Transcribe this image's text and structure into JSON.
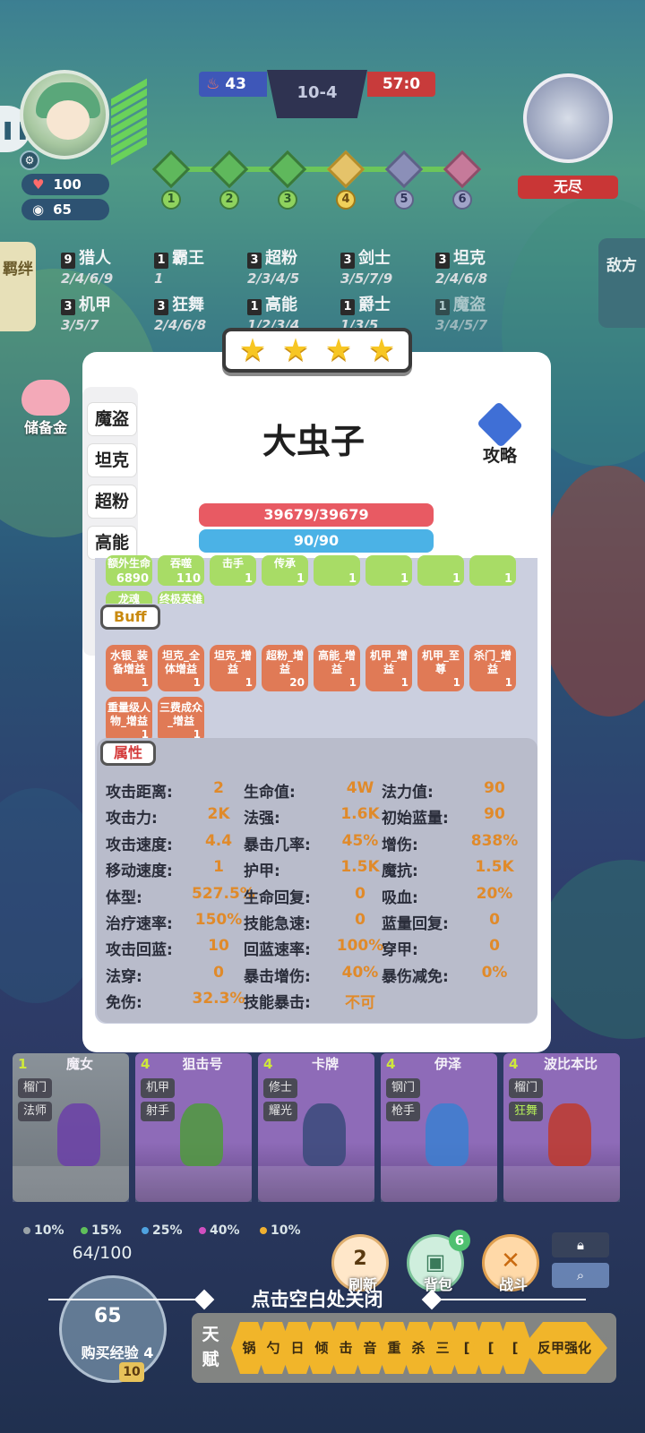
{
  "top": {
    "player_hp": "100",
    "player_coins": "65",
    "score_left": "43",
    "stage": "10-4",
    "score_right": "57:0",
    "round_nodes": [
      "1",
      "2",
      "3",
      "4",
      "5",
      "6"
    ],
    "enemy_label": "无尽"
  },
  "side_tabs": {
    "left": "羁绊",
    "right": "敌方"
  },
  "traits": [
    {
      "count": "9",
      "name": "猎人",
      "tiers": "2/4/6/9"
    },
    {
      "count": "1",
      "name": "霸王",
      "tiers": "1"
    },
    {
      "count": "3",
      "name": "超粉",
      "tiers": "2/3/4/5"
    },
    {
      "count": "3",
      "name": "剑士",
      "tiers": "3/5/7/9"
    },
    {
      "count": "3",
      "name": "坦克",
      "tiers": "2/4/6/8"
    },
    {
      "count": "3",
      "name": "机甲",
      "tiers": "3/5/7"
    },
    {
      "count": "3",
      "name": "狂舞",
      "tiers": "2/4/6/8"
    },
    {
      "count": "1",
      "name": "高能",
      "tiers": "1/2/3/4"
    },
    {
      "count": "1",
      "name": "爵士",
      "tiers": "1/3/5"
    },
    {
      "count": "1",
      "name": "魔盗",
      "tiers": "3/4/5/7"
    }
  ],
  "piggy_label": "储备金",
  "modal": {
    "stars": 4,
    "name": "大虫子",
    "guide_label": "攻略",
    "tags": [
      "魔盗",
      "坦克",
      "超粉",
      "高能"
    ],
    "hp": "39679/39679",
    "mp": "90/90",
    "equip_chips": [
      {
        "label": "额外生命",
        "value": "6890"
      },
      {
        "label": "吞噬",
        "value": "110"
      },
      {
        "label": "击手",
        "value": "1"
      },
      {
        "label": "传承",
        "value": "1"
      },
      {
        "label": "",
        "value": "1"
      },
      {
        "label": "",
        "value": "1"
      },
      {
        "label": "",
        "value": "1"
      },
      {
        "label": "",
        "value": "1"
      }
    ],
    "equip_chips_row2": [
      {
        "label": "龙魂",
        "value": ""
      },
      {
        "label": "终极英雄",
        "value": ""
      }
    ],
    "buff_title": "Buff",
    "buffs": [
      {
        "label": "水银_装备增益",
        "value": "1"
      },
      {
        "label": "坦克_全体增益",
        "value": "1"
      },
      {
        "label": "坦克_增益",
        "value": "1"
      },
      {
        "label": "超粉_增益",
        "value": "20"
      },
      {
        "label": "高能_增益",
        "value": "1"
      },
      {
        "label": "机甲_增益",
        "value": "1"
      },
      {
        "label": "机甲_至尊",
        "value": "1"
      },
      {
        "label": "杀门_增益",
        "value": "1"
      },
      {
        "label": "重量级人物_增益",
        "value": "1"
      },
      {
        "label": "三费成众_增益",
        "value": "1"
      }
    ],
    "attr_title": "属性",
    "attributes": [
      [
        {
          "k": "攻击距离:",
          "v": "2"
        },
        {
          "k": "生命值:",
          "v": "4W"
        },
        {
          "k": "法力值:",
          "v": "90"
        }
      ],
      [
        {
          "k": "攻击力:",
          "v": "2K"
        },
        {
          "k": "法强:",
          "v": "1.6K"
        },
        {
          "k": "初始蓝量:",
          "v": "90"
        }
      ],
      [
        {
          "k": "攻击速度:",
          "v": "4.4"
        },
        {
          "k": "暴击几率:",
          "v": "45%"
        },
        {
          "k": "增伤:",
          "v": "838%"
        }
      ],
      [
        {
          "k": "移动速度:",
          "v": "1"
        },
        {
          "k": "护甲:",
          "v": "1.5K"
        },
        {
          "k": "魔抗:",
          "v": "1.5K"
        }
      ],
      [
        {
          "k": "体型:",
          "v": "527.5%"
        },
        {
          "k": "生命回复:",
          "v": "0"
        },
        {
          "k": "吸血:",
          "v": "20%"
        }
      ],
      [
        {
          "k": "治疗速率:",
          "v": "150%"
        },
        {
          "k": "技能急速:",
          "v": "0"
        },
        {
          "k": "蓝量回复:",
          "v": "0"
        }
      ],
      [
        {
          "k": "攻击回蓝:",
          "v": "10"
        },
        {
          "k": "回蓝速率:",
          "v": "100%"
        },
        {
          "k": "穿甲:",
          "v": "0"
        }
      ],
      [
        {
          "k": "法穿:",
          "v": "0"
        },
        {
          "k": "暴击增伤:",
          "v": "40%"
        },
        {
          "k": "暴伤减免:",
          "v": "0%"
        }
      ],
      [
        {
          "k": "免伤:",
          "v": "32.3%"
        },
        {
          "k": "技能暴击:",
          "v": "不可"
        }
      ]
    ]
  },
  "shop": [
    {
      "cost": "1",
      "name": "魔女",
      "traits": [
        "榴门",
        "法师"
      ],
      "color": "#8a9299",
      "gray": true,
      "unit": "#6b3fa8"
    },
    {
      "cost": "4",
      "name": "狙击号",
      "traits": [
        "机甲",
        "射手"
      ],
      "color": "#8e6bb8",
      "gray": false,
      "unit": "#4f9a3c"
    },
    {
      "cost": "4",
      "name": "卡牌",
      "traits": [
        "修士",
        "耀光"
      ],
      "color": "#8e6bb8",
      "gray": false,
      "unit": "#3a4a7a"
    },
    {
      "cost": "4",
      "name": "伊泽",
      "traits": [
        "钢门",
        "枪手"
      ],
      "color": "#8e6bb8",
      "gray": false,
      "unit": "#3b7fd0"
    },
    {
      "cost": "4",
      "name": "波比本比",
      "traits": [
        "榴门",
        "狂舞"
      ],
      "color": "#8e6bb8",
      "gray": false,
      "unit": "#c0392b"
    }
  ],
  "odds": [
    {
      "v": "10%",
      "c": "#9aa3a8"
    },
    {
      "v": "15%",
      "c": "#5fc05a"
    },
    {
      "v": "25%",
      "c": "#4fa3e0"
    },
    {
      "v": "40%",
      "c": "#d04fc0"
    },
    {
      "v": "10%",
      "c": "#f0b030"
    }
  ],
  "buttons": {
    "refresh": "刷新",
    "refresh_cost": "2",
    "bag": "背包",
    "bag_badge": "6",
    "battle": "战斗"
  },
  "close_hint": "点击空白处关闭",
  "xp": {
    "progress": "64/100",
    "coins": "65",
    "buy_label": "购买经验",
    "buy_cost": "4",
    "level": "10"
  },
  "talent": {
    "label": "天赋",
    "items": [
      "锅",
      "勺",
      "日",
      "倾",
      "击",
      "音",
      "重",
      "杀",
      "三",
      "[",
      "[",
      "[",
      "反甲强化"
    ]
  }
}
